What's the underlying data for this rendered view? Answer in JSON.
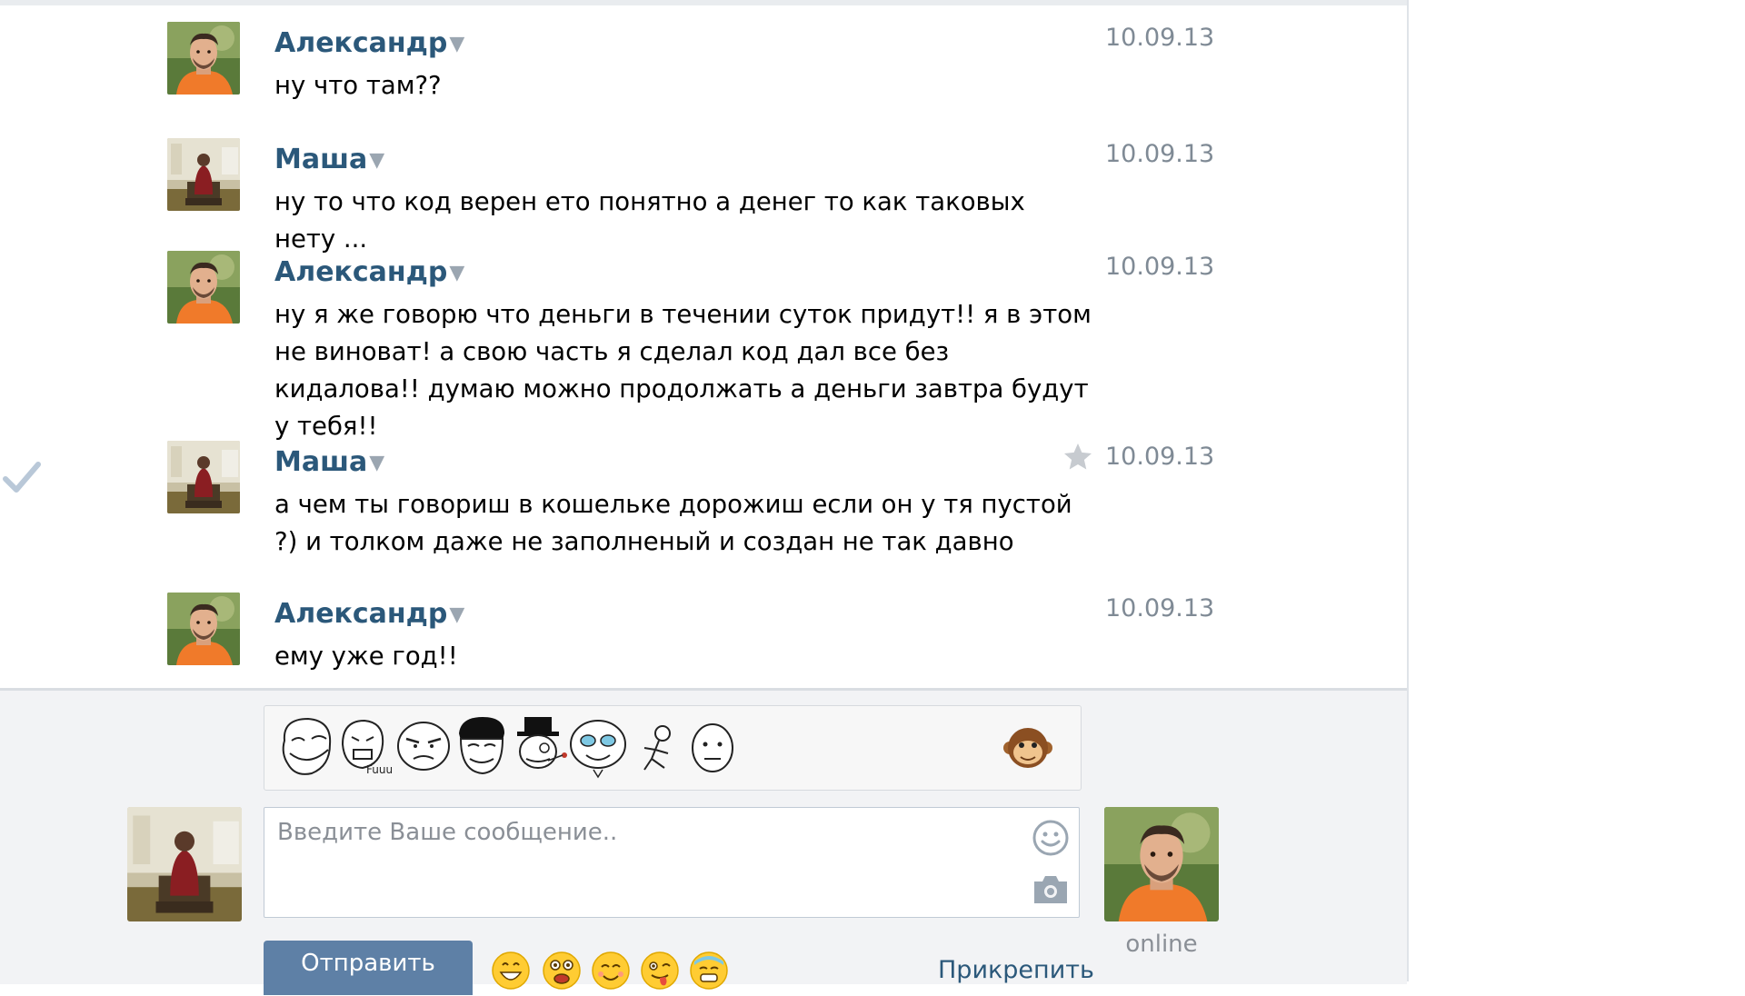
{
  "messages": [
    {
      "author": "Александр",
      "date": "10.09.13",
      "text": "ну что там??",
      "avatar": "alexander"
    },
    {
      "author": "Маша",
      "date": "10.09.13",
      "text": "ну то что код верен ето понятно а денег то как таковых нету ...",
      "avatar": "masha"
    },
    {
      "author": "Александр",
      "date": "10.09.13",
      "text": "ну я же говорю что деньги в течении суток придут!! я в этом не виноват! а свою часть я сделал код дал все без кидалова!! думаю можно продолжать а деньги завтра будут у тебя!!",
      "avatar": "alexander"
    },
    {
      "author": "Маша",
      "date": "10.09.13",
      "text": "а чем ты говориш в кошельке дорожиш если он у тя пустой ?) и толком даже не заполненый и создан не так давно",
      "avatar": "masha",
      "starred": true,
      "checked": true
    },
    {
      "author": "Александр",
      "date": "10.09.13",
      "text": "ему уже год!!",
      "avatar": "alexander"
    }
  ],
  "composer": {
    "placeholder": "Введите Ваше сообщение..",
    "send_label": "Отправить",
    "attach_label": "Прикрепить",
    "peer_status": "online",
    "stickers": [
      "troll-face",
      "fuuu-face",
      "rage-face",
      "yao-ming-face",
      "gentleman-face",
      "happy-cry-face",
      "stick-figure",
      "poker-face"
    ],
    "emojis": [
      "grinning-emoji",
      "surprised-emoji",
      "smiling-emoji",
      "winking-tongue-emoji",
      "cold-sweat-emoji"
    ]
  },
  "colors": {
    "author_name": "#2b587a",
    "send_button": "#5e80a6",
    "composer_bg": "#f2f3f5",
    "date": "#7f8a95"
  }
}
